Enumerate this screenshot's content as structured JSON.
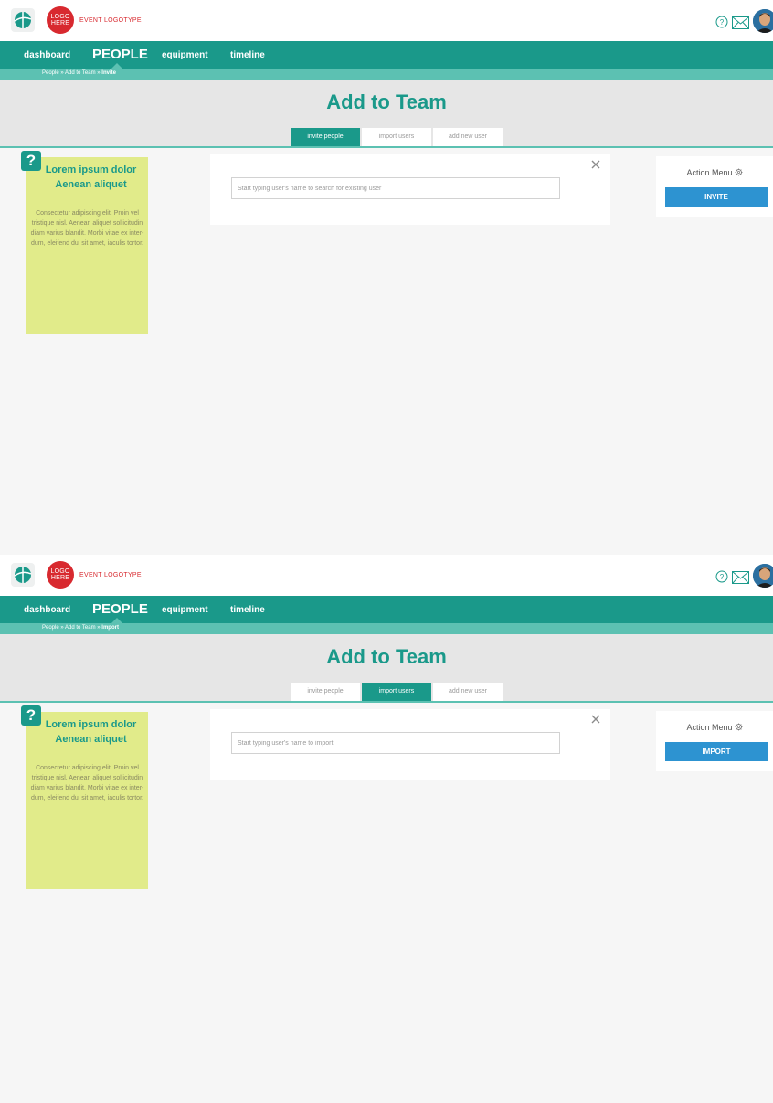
{
  "app": {
    "event_logo_text": "LOGO HERE",
    "event_logotype": "EVENT LOGOTYPE",
    "icons": [
      "app-logo-icon",
      "help-icon",
      "mail-icon",
      "avatar"
    ],
    "colors": {
      "brand": "#1a998a",
      "brand_light": "#5cc1b2",
      "logo_red": "#d8292f",
      "button_blue": "#2d93d1",
      "sticky_yellow": "#e1eb8a"
    }
  },
  "nav": {
    "dashboard": "dashboard",
    "people": "PEOPLE",
    "equipment": "equipment",
    "timeline": "timeline"
  },
  "page": {
    "title": "Add to Team"
  },
  "tabs": {
    "invite": "invite people",
    "import": "import users",
    "add_new": "add new user"
  },
  "sticky": {
    "title": "Lorem ipsum dolor Aenean aliquet",
    "body": "Consectetur adipiscing elit. Proin vel tristique nisl. Aenean aliquet sollicitudin diam varius blandit. Morbi vitae ex inter-dum, eleifend dui sit amet, iaculis tortor."
  },
  "action_menu": {
    "title": "Action Menu"
  },
  "screens": [
    {
      "breadcrumb_prefix": "People » Add to Team » ",
      "breadcrumb_current": "Invite",
      "active_tab": "invite people",
      "search_placeholder": "Start typing user's name to search for existing user",
      "action_button": "INVITE"
    },
    {
      "breadcrumb_prefix": "People » Add to Team » ",
      "breadcrumb_current": "Import",
      "active_tab": "import users",
      "search_placeholder": "Start typing user's name to import",
      "action_button": "IMPORT"
    }
  ]
}
